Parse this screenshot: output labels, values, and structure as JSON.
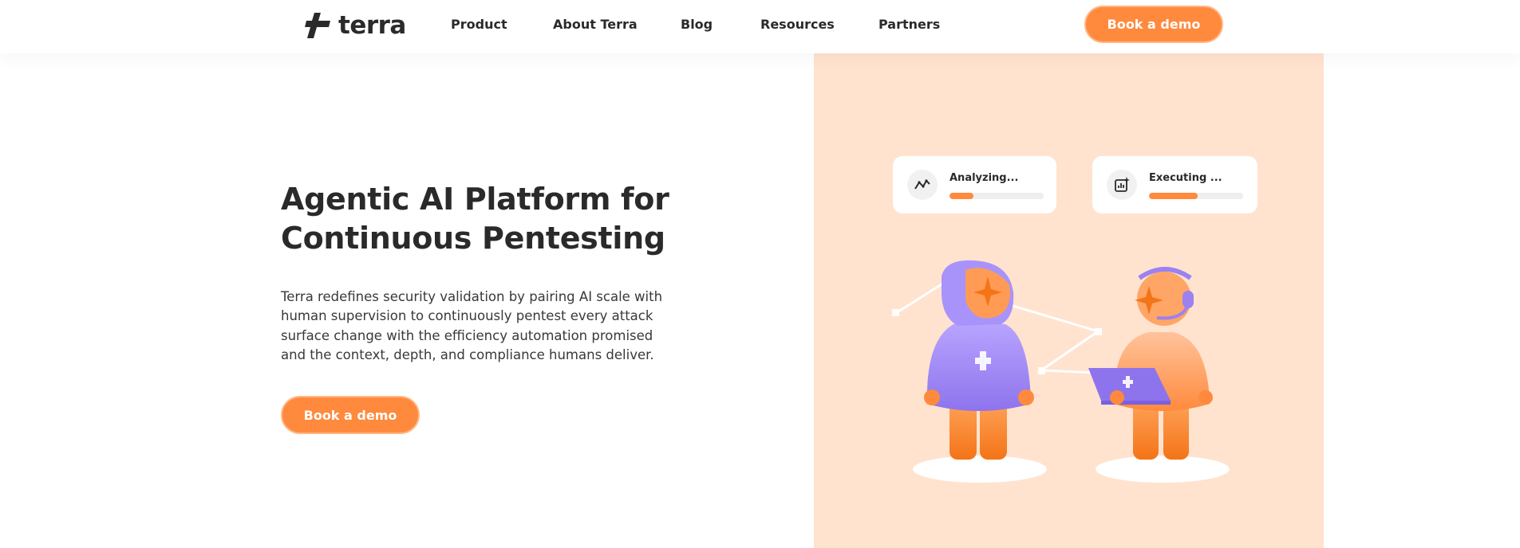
{
  "nav": {
    "logo_text": "terra",
    "links": [
      "Product",
      "About Terra",
      "Blog",
      "Resources",
      "Partners"
    ],
    "cta_label": "Book a demo"
  },
  "hero": {
    "title_line1": "Agentic AI Platform for",
    "title_line2": "Continuous Pentesting",
    "description": "Terra redefines security validation by pairing AI scale with human supervision to continuously pentest every attack surface change with the efficiency automation promised and the context, depth, and compliance humans deliver.",
    "cta_label": "Book a demo"
  },
  "illustration": {
    "cards": [
      {
        "label": "Analyzing...",
        "icon": "activity-line-icon",
        "progress": 0.25
      },
      {
        "label": "Executing ...",
        "icon": "chart-spark-icon",
        "progress": 0.52
      }
    ]
  },
  "colors": {
    "accent": "#ff8a3d",
    "panel_bg": "#ffe3cf",
    "hoodie": "#9b82f0",
    "text": "#2b2a2a"
  }
}
